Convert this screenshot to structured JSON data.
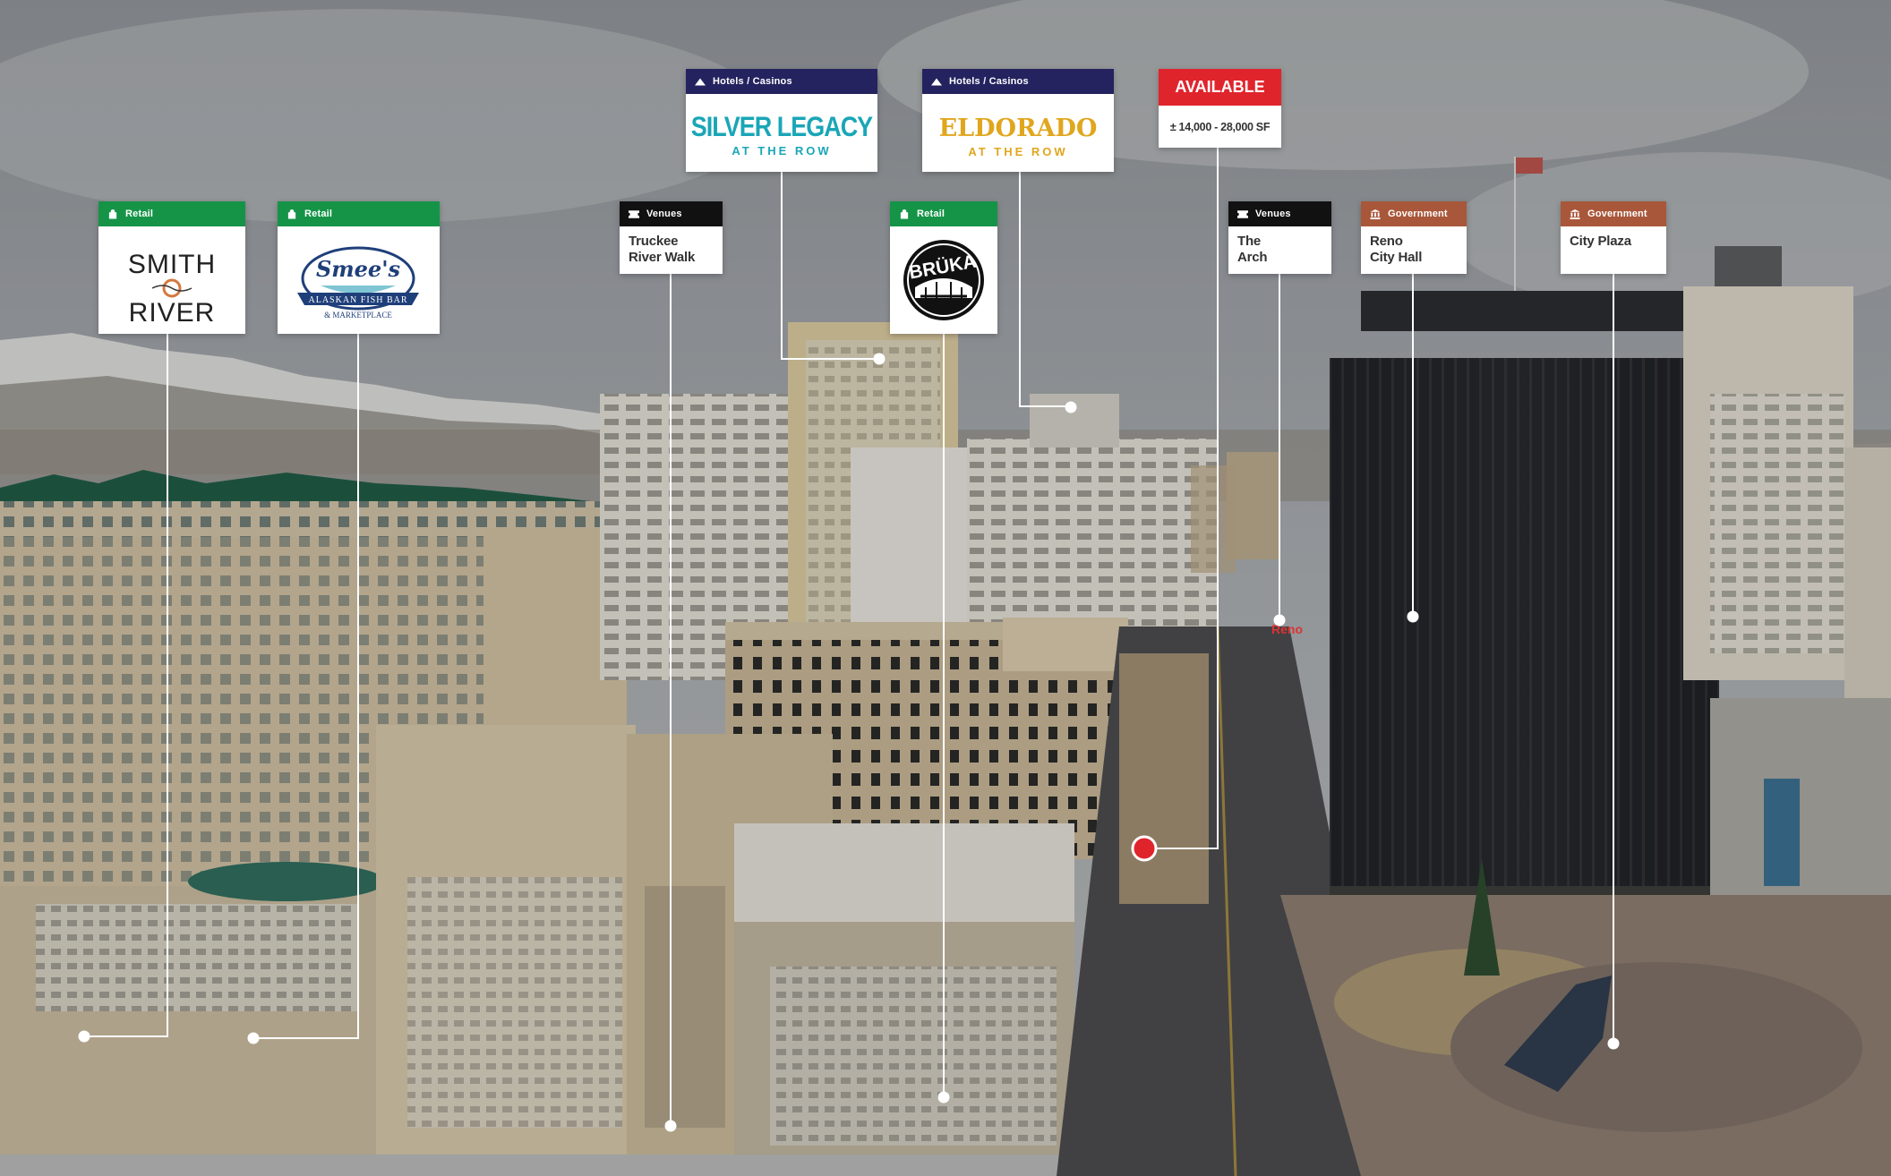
{
  "colors": {
    "retail": "#159447",
    "hotels": "#24235f",
    "venues": "#111111",
    "government": "#a9573a",
    "available": "#e0242c",
    "leader": "#ffffff",
    "marker": "#e0242c"
  },
  "callouts": {
    "smith_river": {
      "category": "Retail",
      "icon": "shopping-bag-icon",
      "logo_line1": "SMITH",
      "logo_line2": "RIVER"
    },
    "smees": {
      "category": "Retail",
      "icon": "shopping-bag-icon",
      "logo_name": "Smee's",
      "logo_banner": "ALASKAN FISH BAR",
      "logo_sub": "& MARKETPLACE"
    },
    "truckee": {
      "category": "Venues",
      "icon": "ticket-icon",
      "line1": "Truckee",
      "line2": "River Walk"
    },
    "silver_legacy": {
      "category": "Hotels / Casinos",
      "icon": "hotel-icon",
      "logo_main": "SILVER LEGACY",
      "logo_sub": "AT THE ROW"
    },
    "eldorado": {
      "category": "Hotels / Casinos",
      "icon": "hotel-icon",
      "logo_main": "ELDORADO",
      "logo_sub": "AT THE ROW"
    },
    "bruka": {
      "category": "Retail",
      "icon": "shopping-bag-icon",
      "logo_text": "BRÜKA"
    },
    "the_arch": {
      "category": "Venues",
      "icon": "ticket-icon",
      "line1": "The",
      "line2": "Arch"
    },
    "city_hall": {
      "category": "Government",
      "icon": "government-building-icon",
      "line1": "Reno",
      "line2": "City Hall"
    },
    "city_plaza": {
      "category": "Government",
      "icon": "government-building-icon",
      "line1": "City Plaza"
    }
  },
  "available": {
    "label": "AVAILABLE",
    "size": "± 14,000 - 28,000 SF"
  },
  "scene": {
    "arch_sign": "Reno"
  }
}
